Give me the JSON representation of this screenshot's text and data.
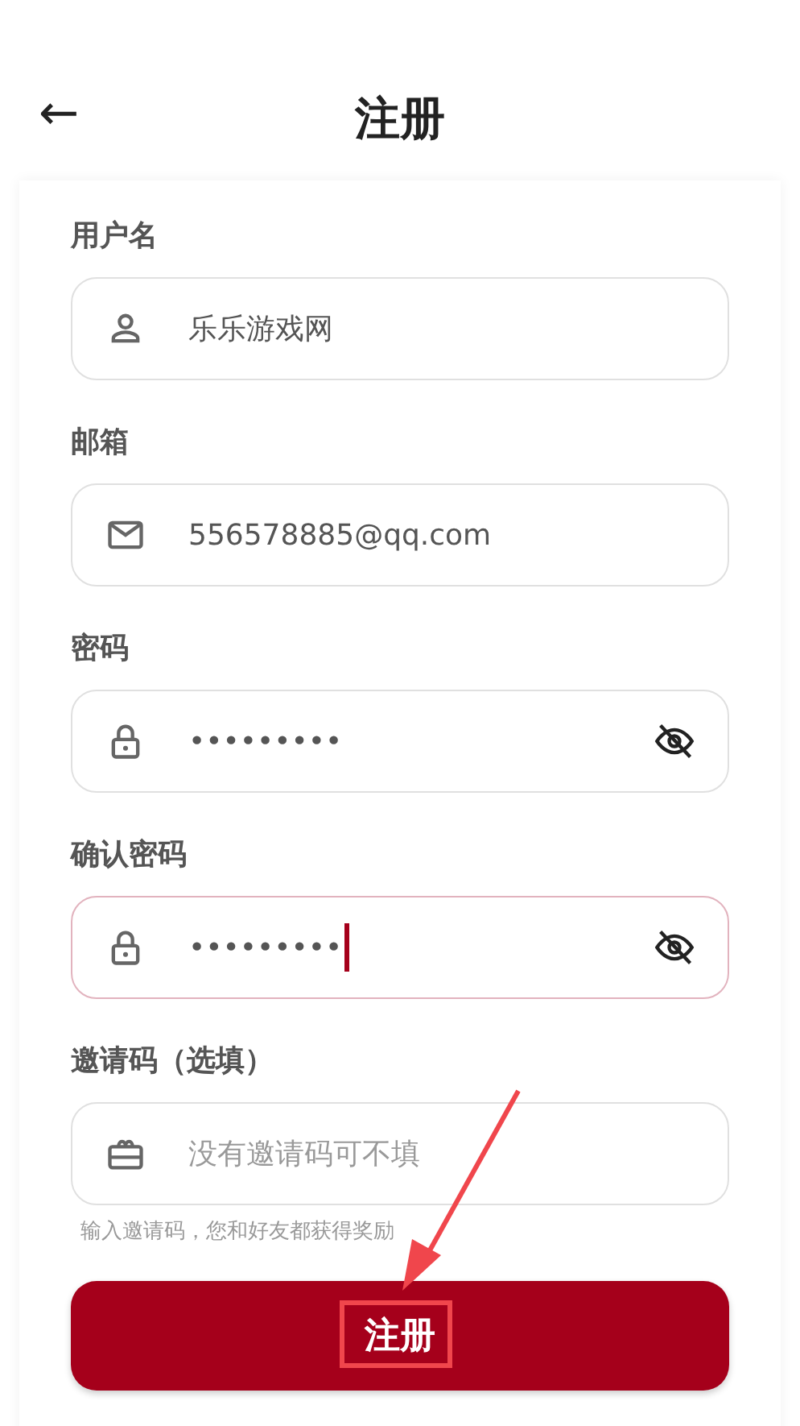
{
  "header": {
    "back": "←",
    "title": "注册"
  },
  "fields": [
    {
      "label": "用户名",
      "kind": "user",
      "value": "乐乐游戏网",
      "focused": false
    },
    {
      "label": "邮箱",
      "kind": "email",
      "value": "556578885@qq.com",
      "focused": false
    },
    {
      "label": "密码",
      "kind": "password",
      "value": "•••••••••",
      "focused": false
    },
    {
      "label": "确认密码",
      "kind": "password",
      "value": "•••••••••",
      "focused": true
    },
    {
      "label": "邀请码（选填）",
      "kind": "invite",
      "placeholder": "没有邀请码可不填",
      "hint": "输入邀请码，您和好友都获得奖励",
      "focused": false
    }
  ],
  "submit": "注册"
}
